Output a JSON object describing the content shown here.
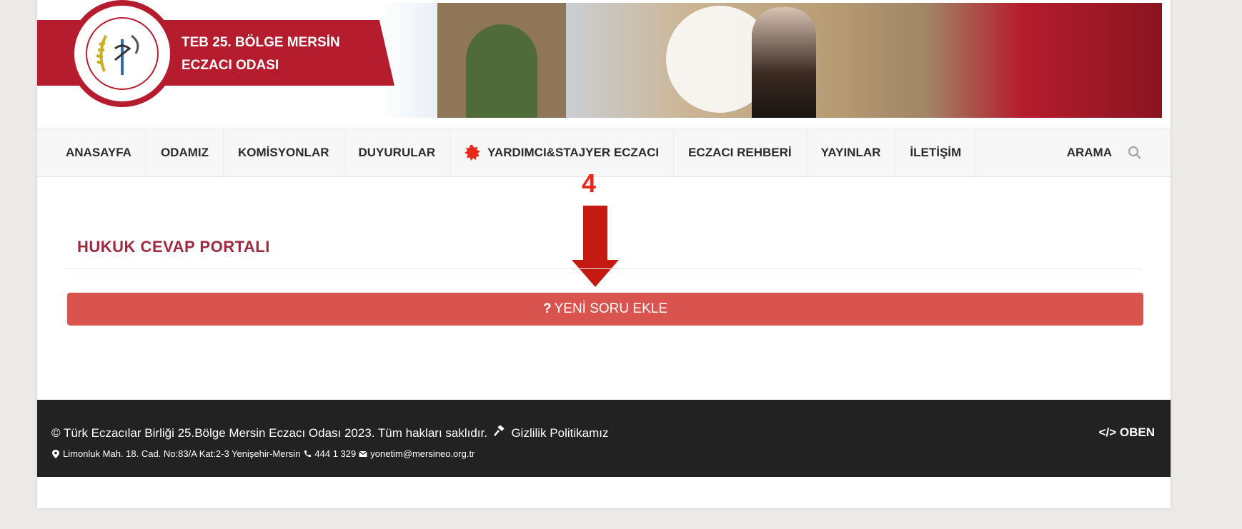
{
  "header": {
    "org_line1": "TEB 25. BÖLGE MERSİN",
    "org_line2": "ECZACI ODASI",
    "logo_icon": "pharmacy-seal-icon",
    "accent_color": "#b51d2e"
  },
  "nav": {
    "items": [
      {
        "label": "ANASAYFA"
      },
      {
        "label": "ODAMIZ"
      },
      {
        "label": "KOMİSYONLAR"
      },
      {
        "label": "DUYURULAR"
      },
      {
        "label": "YARDIMCI&STAJYER ECZACI",
        "icon": "new-badge-icon"
      },
      {
        "label": "ECZACI REHBERİ"
      },
      {
        "label": "YAYINLAR"
      },
      {
        "label": "İLETİŞİM"
      }
    ],
    "search_label": "ARAMA"
  },
  "annotation": {
    "step_number": "4",
    "color": "#e5291d"
  },
  "main": {
    "section_title": "HUKUK CEVAP PORTALI",
    "add_question_icon": "?",
    "add_question_label": "YENİ SORU EKLE",
    "button_color": "#d9534f"
  },
  "footer": {
    "copyright": "© Türk Eczacılar Birliği 25.Bölge Mersin Eczacı Odası 2023. Tüm hakları saklıdır.",
    "privacy_label": "Gizlilik Politikamız",
    "address": "Limonluk Mah. 18. Cad. No:83/A Kat:2-3 Yenişehir-Mersin",
    "phone": "444 1 329",
    "email": "yonetim@mersineo.org.tr",
    "brand": "OBEN"
  }
}
